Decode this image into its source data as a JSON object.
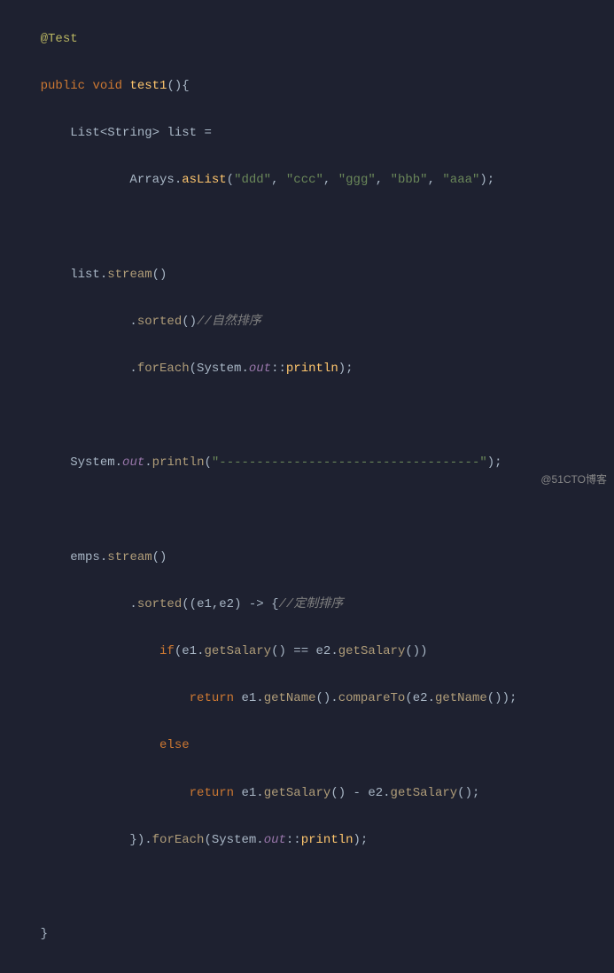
{
  "code": {
    "annotation": "@Test",
    "kw_public": "public",
    "kw_void": "void",
    "method_name": "test1",
    "type_list": "List",
    "type_string": "String",
    "var_list": "list",
    "cls_arrays": "Arrays",
    "m_asList": "asList",
    "str_ddd": "\"ddd\"",
    "str_ccc": "\"ccc\"",
    "str_ggg": "\"ggg\"",
    "str_bbb": "\"bbb\"",
    "str_aaa": "\"aaa\"",
    "m_stream": "stream",
    "m_sorted": "sorted",
    "comment_natural": "//自然排序",
    "m_forEach": "forEach",
    "cls_system": "System",
    "field_out": "out",
    "m_println": "println",
    "str_divider": "\"-----------------------------------\"",
    "var_emps": "emps",
    "p_e1": "e1",
    "p_e2": "e2",
    "comment_custom": "//定制排序",
    "kw_if": "if",
    "m_getSalary": "getSalary",
    "kw_return": "return",
    "m_getName": "getName",
    "m_compareTo": "compareTo",
    "kw_else": "else"
  },
  "watermark": "@51CTO博客"
}
